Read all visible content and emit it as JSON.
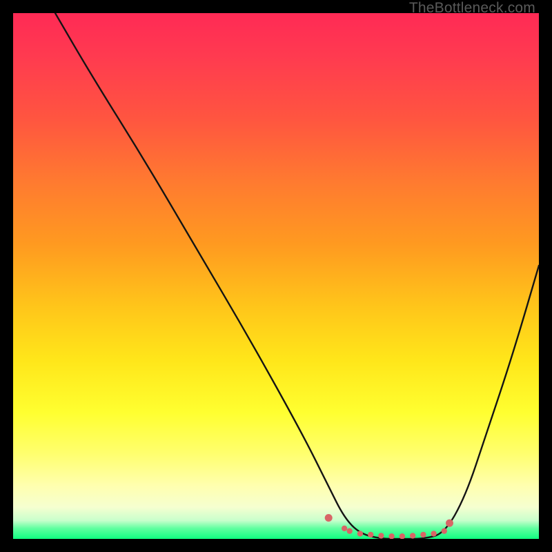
{
  "watermark": {
    "text": "TheBottleneck.com"
  },
  "colors": {
    "page_bg": "#000000",
    "curve_stroke": "#141414",
    "dot_fill": "#d86666",
    "gradient_top": "#ff2a55",
    "gradient_bottom": "#10ff80"
  },
  "chart_data": {
    "type": "line",
    "title": "",
    "xlabel": "",
    "ylabel": "",
    "xlim": [
      0,
      100
    ],
    "ylim": [
      0,
      100
    ],
    "note": "Axes are unlabeled in the image; x and y are treated as 0–100 percent of the square plot area. The curve is a V-shaped bottleneck curve with its minimum (the flat trough) around x≈63–82.",
    "series": [
      {
        "name": "bottleneck-curve",
        "x": [
          8,
          15,
          25,
          35,
          45,
          55,
          60,
          63,
          66,
          70,
          74,
          78,
          82,
          86,
          90,
          95,
          100
        ],
        "y": [
          100,
          88,
          72,
          55,
          38,
          20,
          10,
          4,
          1,
          0,
          0,
          0,
          1,
          8,
          20,
          35,
          52
        ]
      }
    ],
    "trough_markers": {
      "name": "pink-dots",
      "x": [
        60,
        63,
        64,
        66,
        68,
        70,
        72,
        74,
        76,
        78,
        80,
        82,
        83
      ],
      "y": [
        4,
        2,
        1.5,
        1,
        0.8,
        0.6,
        0.5,
        0.5,
        0.6,
        0.8,
        1,
        1.5,
        3
      ]
    }
  }
}
